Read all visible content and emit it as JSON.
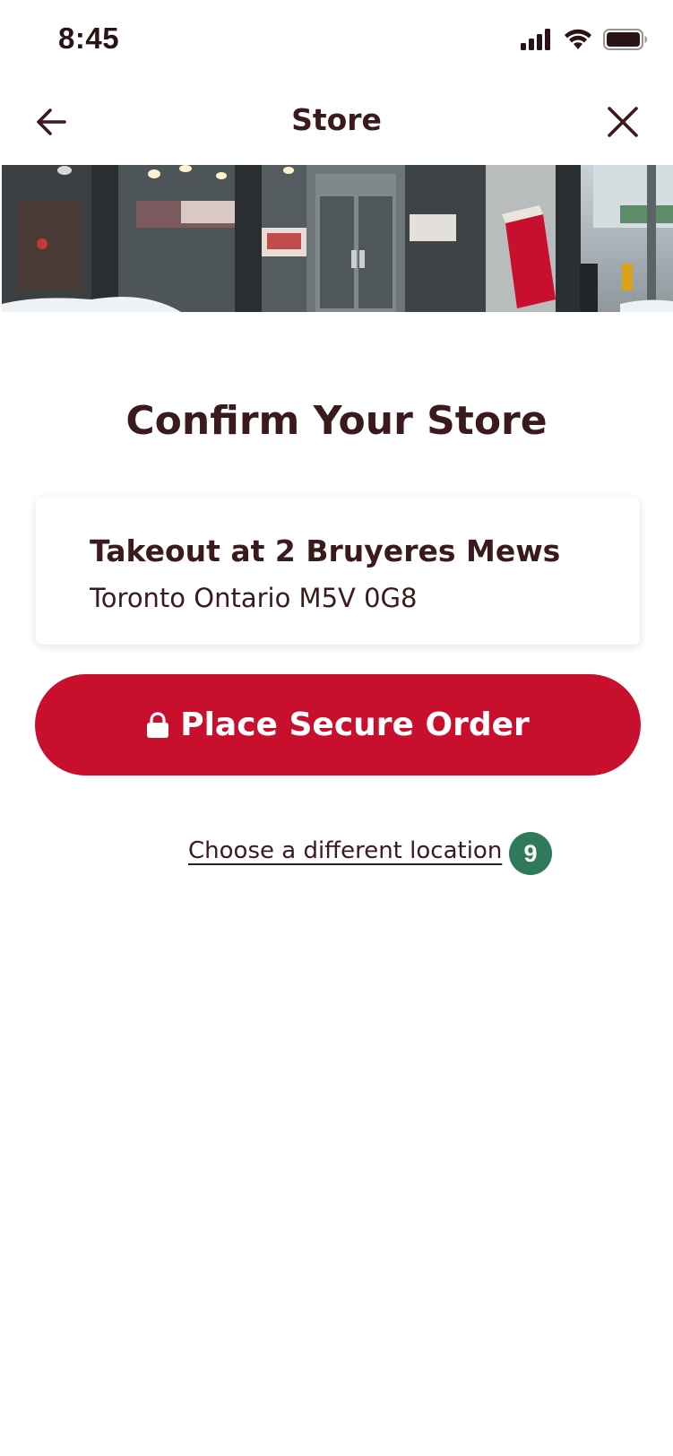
{
  "status_bar": {
    "time": "8:45"
  },
  "nav": {
    "title": "Store"
  },
  "hero": {
    "icon": "store-photo"
  },
  "main": {
    "heading": "Confirm Your Store",
    "store": {
      "name": "Takeout at 2 Bruyeres Mews",
      "address": "Toronto Ontario M5V 0G8"
    },
    "order_button_label": "Place Secure Order",
    "different_location_label": "Choose a different location",
    "badge_count": "9"
  },
  "colors": {
    "brand_red": "#c8102e",
    "text_brown": "#3a1a1c",
    "badge_green": "#2f7a5a"
  }
}
